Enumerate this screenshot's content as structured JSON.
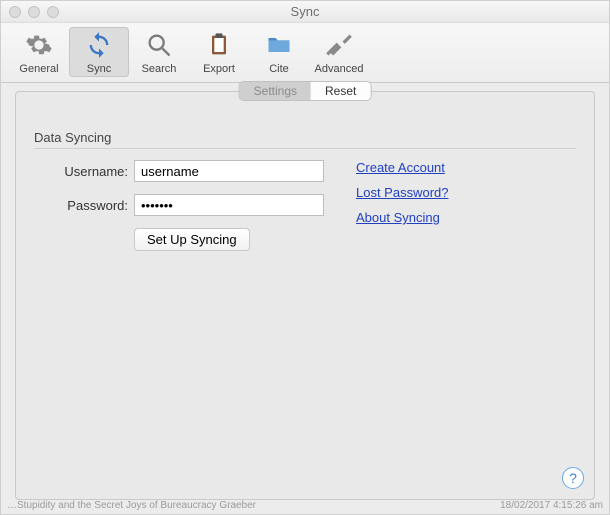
{
  "window": {
    "title": "Sync"
  },
  "toolbar": {
    "items": [
      {
        "label": "General"
      },
      {
        "label": "Sync"
      },
      {
        "label": "Search"
      },
      {
        "label": "Export"
      },
      {
        "label": "Cite"
      },
      {
        "label": "Advanced"
      }
    ]
  },
  "tabs": {
    "settings": "Settings",
    "reset": "Reset"
  },
  "section": {
    "title": "Data Syncing"
  },
  "form": {
    "username_label": "Username:",
    "username_value": "username",
    "password_label": "Password:",
    "password_value": "•••••••",
    "setup_label": "Set Up Syncing"
  },
  "links": {
    "create": "Create Account",
    "lost": "Lost Password?",
    "about": "About Syncing"
  },
  "help": "?",
  "footer": {
    "left": "…Stupidity and the Secret Joys of Bureaucracy  Graeber",
    "right": "18/02/2017  4:15:26 am"
  }
}
